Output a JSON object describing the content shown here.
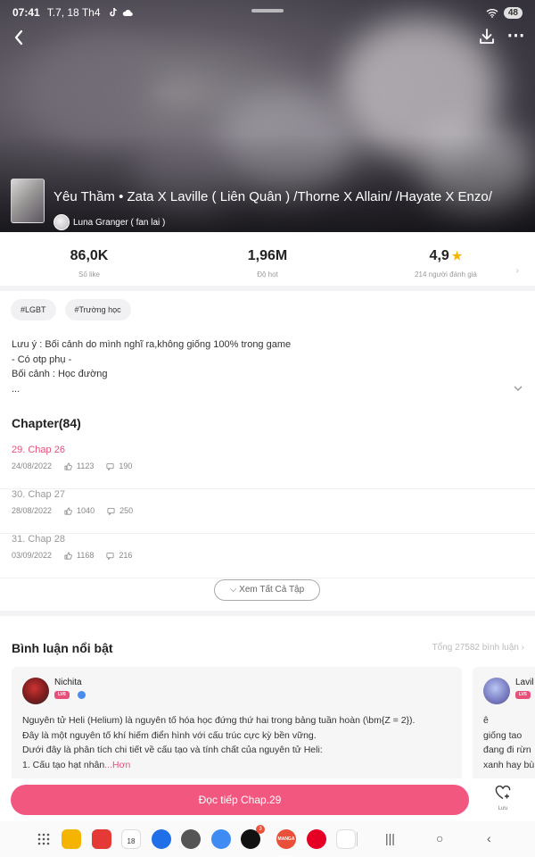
{
  "status_bar": {
    "time": "07:41",
    "date": "T.7, 18 Th4",
    "battery": "48"
  },
  "story": {
    "title": "Yêu Thầm • Zata X Laville ( Liên Quân ) /Thorne X Allain/ /Hayate X Enzo/",
    "author": "Luna Granger ( fan lai )"
  },
  "stats": [
    {
      "value": "86,0K",
      "label": "Số like"
    },
    {
      "value": "1,96M",
      "label": "Độ hot"
    },
    {
      "value": "4,9",
      "label": "214 người đánh giá"
    }
  ],
  "tags": [
    "#LGBT",
    "#Trường học"
  ],
  "description": [
    "Lưu ý : Bối cảnh do mình nghĩ ra,không giống 100% trong game",
    "- Có otp phụ -",
    "Bối cảnh : Học đường",
    "..."
  ],
  "chapters": {
    "title": "Chapter(84)",
    "items": [
      {
        "name": "29. Chap 26",
        "date": "24/08/2022",
        "likes": "1123",
        "comments": "190"
      },
      {
        "name": "30. Chap 27",
        "date": "28/08/2022",
        "likes": "1040",
        "comments": "250"
      },
      {
        "name": "31. Chap 28",
        "date": "03/09/2022",
        "likes": "1168",
        "comments": "216"
      }
    ],
    "view_all": "Xem Tất Cả Tập"
  },
  "comments": {
    "title": "Bình luận nổi bật",
    "total": "Tổng 27582 bình luận",
    "items": [
      {
        "user": "Nichita",
        "level": "LV6",
        "lines": [
          "Nguyên tử Heli (Helium) là nguyên tố hóa học đứng thứ hai trong bảng tuần hoàn (\\bm{Z = 2}).",
          "Đây là một nguyên tố khí hiếm điển hình với cấu trúc cực kỳ bền vững.",
          "Dưới đây là phân tích chi tiết về cấu tạo và tính chất của nguyên tử Heli:",
          "1. Cấu tạo hạt nhân"
        ],
        "more": "...Hơn"
      },
      {
        "user": "Lavil",
        "level": "LV5",
        "lines": [
          "ê",
          "giống tao",
          "đang đi rừn",
          "xanh hay bù"
        ]
      }
    ]
  },
  "actions": {
    "read_next": "Đọc tiếp Chap.29",
    "save": "Lưu"
  },
  "dock": {
    "calendar_day": "18",
    "tiktok_badge": "3",
    "mangatoon": "MANGA TOON"
  },
  "colors": {
    "accent": "#f2587f",
    "highlight": "#e8507a",
    "star": "#f6b400"
  }
}
